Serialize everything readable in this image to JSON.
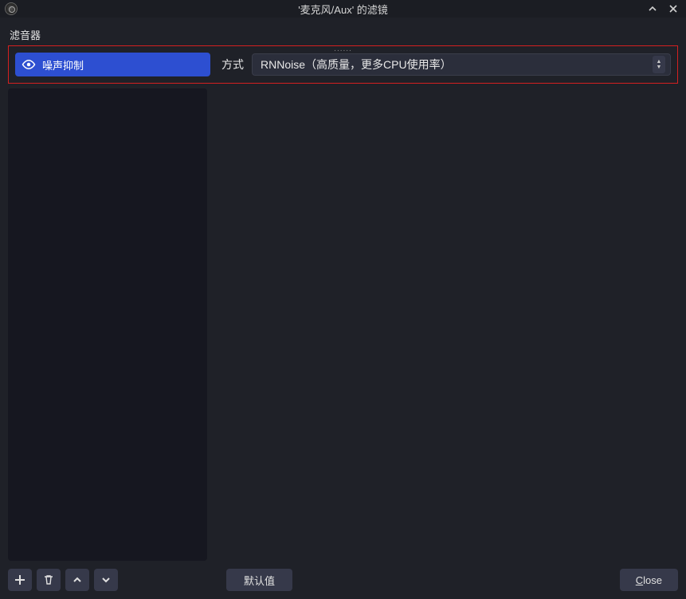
{
  "titlebar": {
    "title": "'麦克风/Aux' 的滤镜"
  },
  "section": {
    "filters_label": "滤音器",
    "drag_handle": "......"
  },
  "filters": [
    {
      "name": "噪声抑制",
      "visible": true
    }
  ],
  "property": {
    "label": "方式",
    "selected": "RNNoise（高质量，更多CPU使用率）"
  },
  "buttons": {
    "add_tooltip": "添加",
    "remove_tooltip": "删除",
    "move_up_tooltip": "上移",
    "move_down_tooltip": "下移",
    "defaults_label": "默认值",
    "close_label_prefix": "C",
    "close_label_rest": "lose"
  },
  "window_buttons": {
    "minimize": "minimize",
    "close": "close"
  }
}
